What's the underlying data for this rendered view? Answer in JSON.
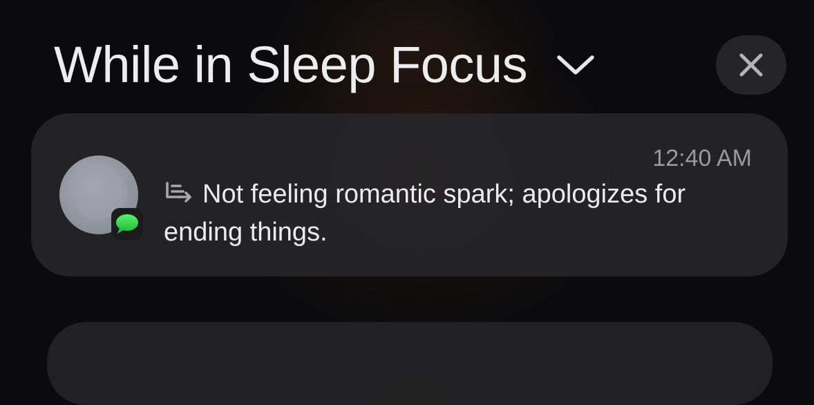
{
  "header": {
    "title": "While in Sleep Focus"
  },
  "notification": {
    "timestamp": "12:40 AM",
    "message": "Not feeling romantic spark; apologizes for ending things.",
    "app_icon": "messages-icon",
    "summary_icon": "summary-icon"
  },
  "colors": {
    "background": "#0b0b0d",
    "card": "#262628",
    "badge_green": "#34c759",
    "timestamp": "#9a9a9e"
  }
}
